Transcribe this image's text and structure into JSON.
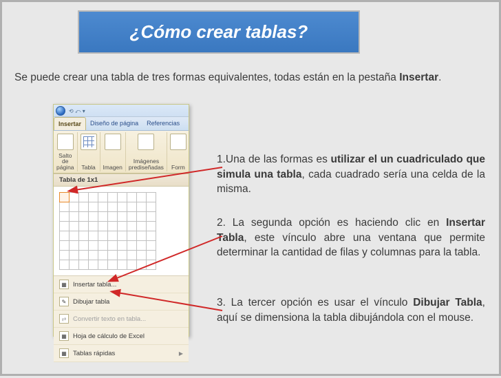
{
  "title": "¿Cómo crear tablas?",
  "intro": {
    "pre": "Se puede crear una tabla de tres formas equivalentes, todas están en la pestaña ",
    "bold": "Insertar",
    "post": "."
  },
  "shot": {
    "tabs": {
      "active": "Insertar",
      "t2": "Diseño de página",
      "t3": "Referencias"
    },
    "groups": {
      "g1a": "Salto de",
      "g1b": "página",
      "g2a": "Tabla",
      "g3a": "Imagen",
      "g4a": "Imágenes",
      "g4b": "prediseñadas",
      "g5a": "Form"
    },
    "dropdown_header": "Tabla de 1x1",
    "menu": {
      "m1": "Insertar tabla...",
      "m2": "Dibujar tabla",
      "m3": "Convertir texto en tabla...",
      "m4": "Hoja de cálculo de Excel",
      "m5": "Tablas rápidas"
    }
  },
  "paras": {
    "p1": {
      "a": "1.Una de las formas es ",
      "b": "utilizar el un cuadriculado que simula una tabla",
      "c": ", cada cuadrado sería una celda de la misma."
    },
    "p2": {
      "a": "2. La segunda opción es haciendo clic en ",
      "b": "Insertar Tabla",
      "c": ", este vínculo abre una ventana que permite determinar la cantidad de filas y columnas para la tabla."
    },
    "p3": {
      "a": "3. La tercer opción es usar el vínculo ",
      "b": "Dibujar Tabla",
      "c": ", aquí se dimensiona la tabla dibujándola con el mouse."
    }
  }
}
